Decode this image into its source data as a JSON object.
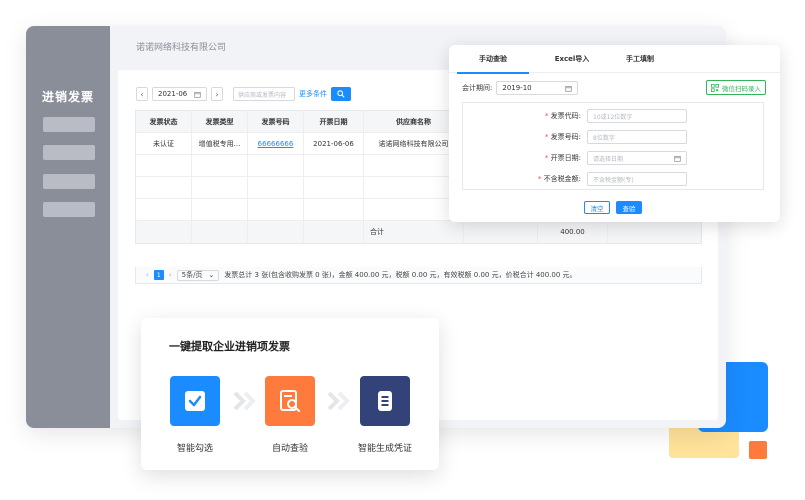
{
  "sidebar": {
    "title": "进销发票"
  },
  "header": {
    "company": "诺诺网络科技有限公司"
  },
  "filter": {
    "date": "2021-06",
    "search_placeholder": "供应商或发票内容",
    "more_label": "更多条件"
  },
  "table": {
    "columns": [
      "发票状态",
      "发票类型",
      "发票号码",
      "开票日期",
      "供应商名称"
    ],
    "rows": [
      [
        "未认证",
        "增值税专用...",
        "66666666",
        "2021-06-06",
        "诺诺网络科技有限公司"
      ]
    ],
    "total_label": "合计",
    "total_value": "400.00"
  },
  "pager": {
    "current_page": "1",
    "page_size": "5条/页",
    "summary": "发票总计 3 张(包含收购发票 0 张)，金额 400.00 元，税额 0.00 元，有效税额 0.00 元，价税合计 400.00 元。"
  },
  "form": {
    "tabs": [
      "手动查验",
      "Excel导入",
      "手工填制"
    ],
    "period_label": "会计期间:",
    "period_value": "2019-10",
    "scan_label": "微信扫码录入",
    "fields": [
      {
        "label": "发票代码:",
        "placeholder": "10或12位数字"
      },
      {
        "label": "发票号码:",
        "placeholder": "8位数字"
      },
      {
        "label": "开票日期:",
        "placeholder": "请选择日期"
      },
      {
        "label": "不含税金额:",
        "placeholder": "不含税金额(专)"
      }
    ],
    "clear_label": "清空",
    "query_label": "查验"
  },
  "feature": {
    "title": "一键提取企业进销项发票",
    "items": [
      {
        "label": "智能勾选",
        "icon": "checkbox-icon"
      },
      {
        "label": "自动查验",
        "icon": "search-document-icon"
      },
      {
        "label": "智能生成凭证",
        "icon": "document-list-icon"
      }
    ]
  },
  "colors": {
    "accent": "#1a8cff",
    "sidebar": "#8a8e99",
    "orange": "#ff7a3d",
    "navy": "#33437a",
    "green": "#34b45a",
    "yellow": "#ffd96b"
  }
}
